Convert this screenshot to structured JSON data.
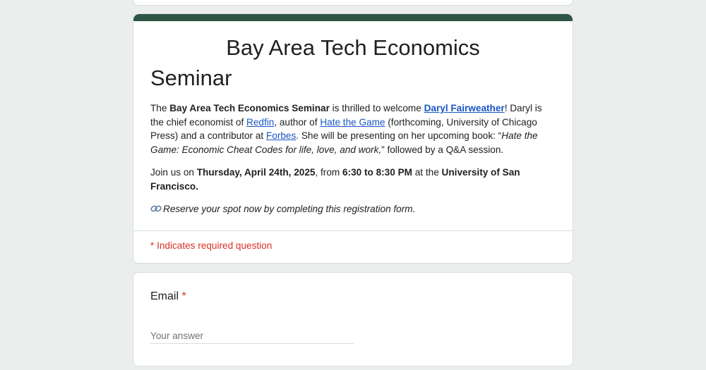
{
  "form": {
    "title_line1": "Bay Area Tech Economics",
    "title_line2": "Seminar",
    "description": {
      "p1": {
        "t1": "The ",
        "seminar_name": "Bay Area Tech Economics Seminar",
        "t2": " is thrilled to welcome ",
        "speaker_link": "Daryl Fairweather",
        "t3": "! Daryl is the chief economist of ",
        "redfin_link": "Redfin",
        "t4": ", author of ",
        "book_link": "Hate the Game",
        "t5": " (forthcoming, University of Chicago Press) and a contributor at ",
        "forbes_link": "Forbes",
        "t6": ". She will be presenting on her upcoming book: “",
        "book_title": "Hate the Game: Economic Cheat Codes for life, love, and work,",
        "t7": "” followed by a Q&A session."
      },
      "p2": {
        "t1": "Join us on ",
        "date": "Thursday, April 24th, 2025",
        "t2": ", from ",
        "time": "6:30 to 8:30 PM",
        "t3": " at the ",
        "venue": "University of San Francisco."
      },
      "p3": {
        "icon": "link-icon",
        "text": "Reserve your spot now by completing this registration form."
      }
    },
    "required_note": "* Indicates required question",
    "questions": [
      {
        "label": "Email",
        "required_mark": "*",
        "placeholder": "Your answer",
        "value": ""
      }
    ]
  },
  "colors": {
    "accent": "#2f5545",
    "background": "#eaeeed",
    "link": "#1a56c4",
    "required": "#d93025"
  }
}
